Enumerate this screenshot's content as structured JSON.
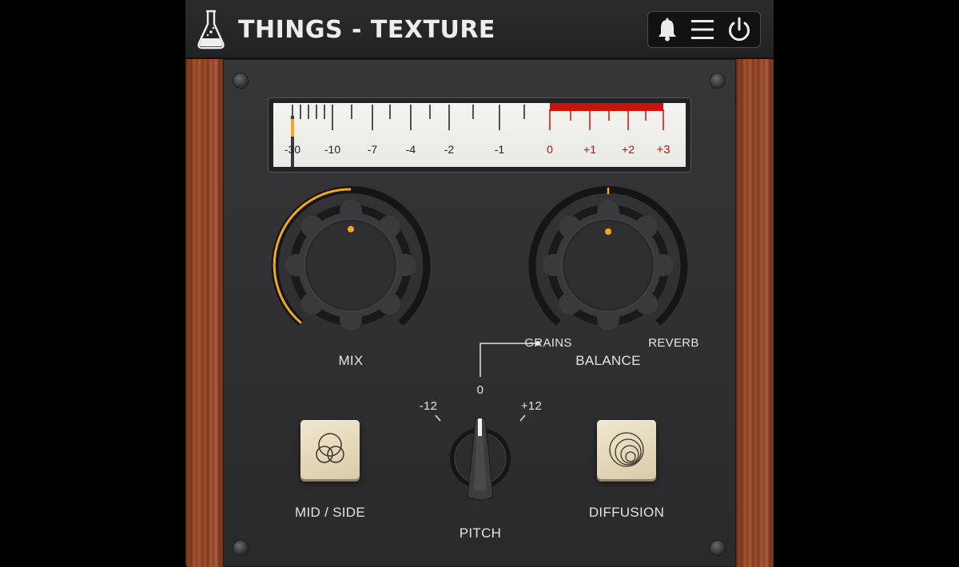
{
  "app": {
    "title": "THINGS - TEXTURE"
  },
  "header": {
    "logo_icon": "flask-icon",
    "buttons": [
      {
        "name": "notifications-button",
        "icon": "bell-icon"
      },
      {
        "name": "menu-button",
        "icon": "hamburger-menu-icon"
      },
      {
        "name": "power-button",
        "icon": "power-icon"
      }
    ]
  },
  "meter": {
    "labels": [
      "-30",
      "-10",
      "-7",
      "-4",
      "-2",
      "-1",
      "0",
      "+1",
      "+2",
      "+3"
    ],
    "red_labels": [
      "0",
      "+1",
      "+2",
      "+3"
    ],
    "level": "-30",
    "colors": {
      "scale": "#222222",
      "red_zone": "#c81010",
      "needle_peak": "#f5a623"
    }
  },
  "mix": {
    "label": "MIX",
    "value_fraction": 0.5,
    "accent": "#f5a623"
  },
  "balance": {
    "label": "BALANCE",
    "left_label": "GRAINS",
    "right_label": "REVERB",
    "value_fraction": 0.5
  },
  "pitch": {
    "label": "PITCH",
    "scale": {
      "min": "-12",
      "center": "0",
      "max": "+12"
    },
    "value": "0"
  },
  "mid_side": {
    "label": "MID / SIDE",
    "icon": "mid-side-icon"
  },
  "diffusion": {
    "label": "DIFFUSION",
    "icon": "diffusion-circles-icon"
  },
  "colors": {
    "accent": "#f5a623",
    "panel": "#303032",
    "text": "#e4e4e4",
    "button": "#e8dcc0"
  }
}
